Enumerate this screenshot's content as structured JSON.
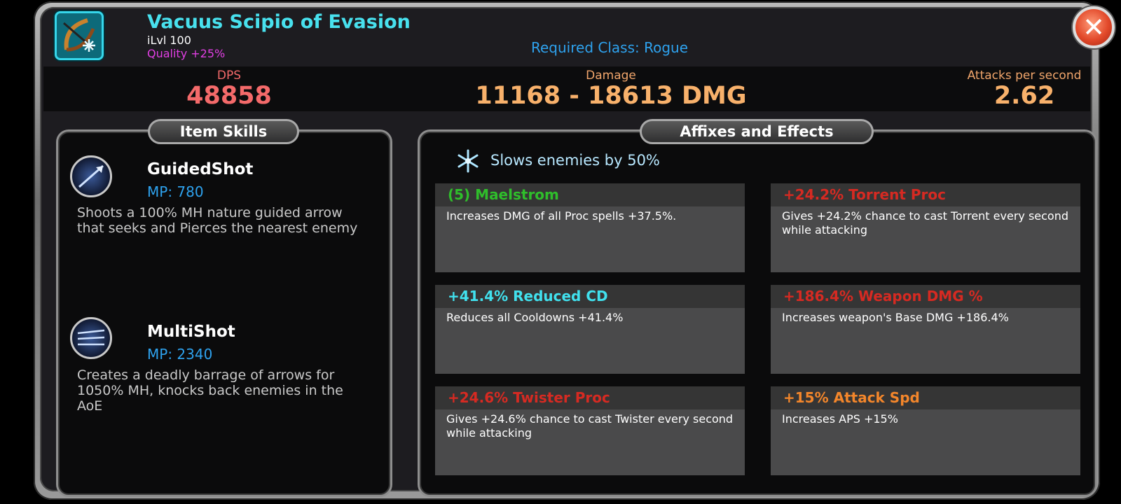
{
  "item": {
    "name": "Vacuus Scipio of Evasion",
    "ilvl": "iLvl 100",
    "quality": "Quality +25%",
    "required_class": "Required Class: Rogue",
    "icon": "bow-frost-icon"
  },
  "stats": {
    "dps_label": "DPS",
    "dps_value": "48858",
    "damage_label": "Damage",
    "damage_value": "11168 - 18613 DMG",
    "aps_label": "Attacks per second",
    "aps_value": "2.62"
  },
  "skills_panel": {
    "title": "Item Skills",
    "skills": [
      {
        "name": "GuidedShot",
        "mp": "MP: 780",
        "description": "Shoots a 100% MH nature guided arrow that seeks and Pierces the nearest enemy",
        "icon": "guided-arrow-icon"
      },
      {
        "name": "MultiShot",
        "mp": "MP: 2340",
        "description": "Creates a deadly barrage of arrows for 1050% MH, knocks back enemies in the AoE",
        "icon": "multi-arrow-icon"
      }
    ]
  },
  "affixes_panel": {
    "title": "Affixes and Effects",
    "effect": "Slows enemies by 50%",
    "effect_icon": "snowflake-icon",
    "affixes": [
      {
        "title": "(5) Maelstrom",
        "description": "Increases DMG of all Proc spells +37.5%.",
        "color": "#2fbe2b"
      },
      {
        "title": "+24.2% Torrent Proc",
        "description": "Gives +24.2% chance to cast Torrent every second while attacking",
        "color": "#d62a22"
      },
      {
        "title": "+41.4% Reduced CD",
        "description": "Reduces all Cooldowns +41.4%",
        "color": "#41e1ee"
      },
      {
        "title": "+186.4% Weapon DMG %",
        "description": "Increases weapon's Base DMG +186.4%",
        "color": "#d62a22"
      },
      {
        "title": "+24.6% Twister Proc",
        "description": "Gives +24.6% chance to cast Twister every second while attacking",
        "color": "#d62a22"
      },
      {
        "title": "+15% Attack Spd",
        "description": "Increases APS +15%",
        "color": "#f3862b"
      }
    ]
  },
  "close_icon": "close-icon"
}
